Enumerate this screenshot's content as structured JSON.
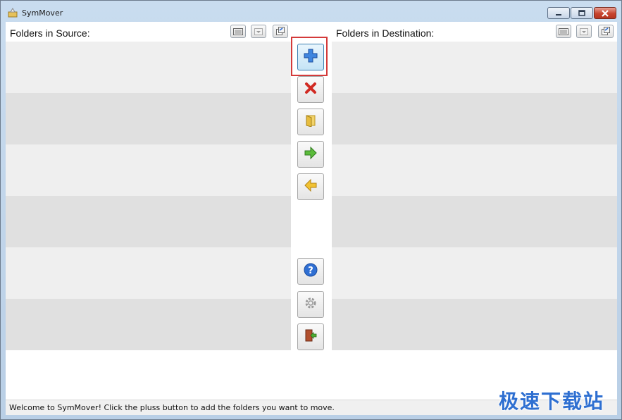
{
  "window": {
    "title": "SymMover",
    "title_icon": "symmover-app-icon",
    "controls": [
      "minimize-icon",
      "maximize-icon",
      "close-icon"
    ]
  },
  "source_panel": {
    "title": "Folders in Source:",
    "toolbar_icons": [
      "list-view-icon",
      "dropdown-icon",
      "export-icon"
    ],
    "rows": [
      "",
      "",
      "",
      "",
      "",
      ""
    ]
  },
  "destination_panel": {
    "title": "Folders in Destination:",
    "toolbar_icons": [
      "list-view-icon",
      "dropdown-icon",
      "export-icon"
    ],
    "rows": [
      "",
      "",
      "",
      "",
      "",
      ""
    ]
  },
  "actions": [
    {
      "icon": "plus-icon",
      "state": "highlighted"
    },
    {
      "icon": "remove-x-icon"
    },
    {
      "icon": "folder-icon"
    },
    {
      "icon": "arrow-right-icon"
    },
    {
      "icon": "arrow-left-icon"
    },
    {
      "icon": "help-icon"
    },
    {
      "icon": "settings-gear-icon"
    },
    {
      "icon": "exit-door-icon"
    }
  ],
  "status_bar": {
    "text": "Welcome to SymMover! Click the pluss button to add the folders you want to move."
  },
  "watermark": {
    "text": "极速下载站"
  },
  "colors": {
    "row_light": "#efefef",
    "row_dark": "#e0e0e0",
    "highlight_border": "#d43a3a",
    "watermark": "#2e6fd1"
  }
}
